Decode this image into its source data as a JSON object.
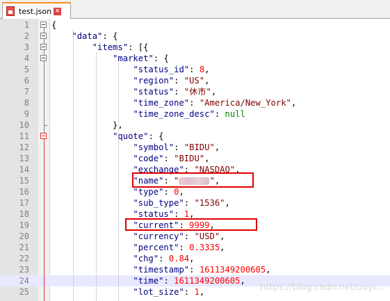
{
  "tab": {
    "title": "test.json",
    "close_symbol": "×",
    "file_icon": "file-icon"
  },
  "watermark": "https://blog.csdn.net/ouyi...",
  "colors": {
    "key": "#000080",
    "string": "#800000",
    "number": "#ff0000",
    "keyword": "#008000",
    "highlight_line": "#e8e8ff",
    "annotation_box": "#e00000"
  },
  "highlight_line": 24,
  "annotated_lines": [
    15,
    19
  ],
  "lines": [
    {
      "n": "1",
      "parts": [
        [
          "op",
          "{"
        ]
      ]
    },
    {
      "n": "2",
      "parts": [
        [
          "op",
          "    "
        ],
        [
          "key",
          "\"data\""
        ],
        [
          "op",
          ": {"
        ]
      ]
    },
    {
      "n": "3",
      "parts": [
        [
          "op",
          "        "
        ],
        [
          "key",
          "\"items\""
        ],
        [
          "op",
          ": [{"
        ]
      ]
    },
    {
      "n": "4",
      "parts": [
        [
          "op",
          "            "
        ],
        [
          "key",
          "\"market\""
        ],
        [
          "op",
          ": {"
        ]
      ]
    },
    {
      "n": "5",
      "parts": [
        [
          "op",
          "                "
        ],
        [
          "key",
          "\"status_id\""
        ],
        [
          "op",
          ": "
        ],
        [
          "num",
          "8"
        ],
        [
          "op",
          ","
        ]
      ]
    },
    {
      "n": "6",
      "parts": [
        [
          "op",
          "                "
        ],
        [
          "key",
          "\"region\""
        ],
        [
          "op",
          ": "
        ],
        [
          "str",
          "\"US\""
        ],
        [
          "op",
          ","
        ]
      ]
    },
    {
      "n": "7",
      "parts": [
        [
          "op",
          "                "
        ],
        [
          "key",
          "\"status\""
        ],
        [
          "op",
          ": "
        ],
        [
          "str",
          "\"休市\""
        ],
        [
          "op",
          ","
        ]
      ]
    },
    {
      "n": "8",
      "parts": [
        [
          "op",
          "                "
        ],
        [
          "key",
          "\"time_zone\""
        ],
        [
          "op",
          ": "
        ],
        [
          "str",
          "\"America/New_York\""
        ],
        [
          "op",
          ","
        ]
      ]
    },
    {
      "n": "9",
      "parts": [
        [
          "op",
          "                "
        ],
        [
          "key",
          "\"time_zone_desc\""
        ],
        [
          "op",
          ": "
        ],
        [
          "kw",
          "null"
        ]
      ]
    },
    {
      "n": "10",
      "parts": [
        [
          "op",
          "            },"
        ]
      ]
    },
    {
      "n": "11",
      "parts": [
        [
          "op",
          "            "
        ],
        [
          "key",
          "\"quote\""
        ],
        [
          "op",
          ": {"
        ]
      ]
    },
    {
      "n": "12",
      "parts": [
        [
          "op",
          "                "
        ],
        [
          "key",
          "\"symbol\""
        ],
        [
          "op",
          ": "
        ],
        [
          "str",
          "\"BIDU\""
        ],
        [
          "op",
          ","
        ]
      ]
    },
    {
      "n": "13",
      "parts": [
        [
          "op",
          "                "
        ],
        [
          "key",
          "\"code\""
        ],
        [
          "op",
          ": "
        ],
        [
          "str",
          "\"BIDU\""
        ],
        [
          "op",
          ","
        ]
      ]
    },
    {
      "n": "14",
      "parts": [
        [
          "op",
          "                "
        ],
        [
          "key",
          "\"exchange\""
        ],
        [
          "op",
          ": "
        ],
        [
          "str",
          "\"NASDAQ\""
        ],
        [
          "op",
          ","
        ]
      ]
    },
    {
      "n": "15",
      "parts": [
        [
          "op",
          "                "
        ],
        [
          "key",
          "\"name\""
        ],
        [
          "op",
          ": "
        ],
        [
          "str",
          "\""
        ],
        [
          "blur",
          ""
        ],
        [
          "str",
          "\""
        ],
        [
          "op",
          ","
        ]
      ]
    },
    {
      "n": "16",
      "parts": [
        [
          "op",
          "                "
        ],
        [
          "key",
          "\"type\""
        ],
        [
          "op",
          ": "
        ],
        [
          "num",
          "0"
        ],
        [
          "op",
          ","
        ]
      ]
    },
    {
      "n": "17",
      "parts": [
        [
          "op",
          "                "
        ],
        [
          "key",
          "\"sub_type\""
        ],
        [
          "op",
          ": "
        ],
        [
          "str",
          "\"1536\""
        ],
        [
          "op",
          ","
        ]
      ]
    },
    {
      "n": "18",
      "parts": [
        [
          "op",
          "                "
        ],
        [
          "key",
          "\"status\""
        ],
        [
          "op",
          ": "
        ],
        [
          "num",
          "1"
        ],
        [
          "op",
          ","
        ]
      ]
    },
    {
      "n": "19",
      "parts": [
        [
          "op",
          "                "
        ],
        [
          "key",
          "\"current\""
        ],
        [
          "op",
          ": "
        ],
        [
          "num",
          "9999"
        ],
        [
          "op",
          ","
        ]
      ]
    },
    {
      "n": "20",
      "parts": [
        [
          "op",
          "                "
        ],
        [
          "key",
          "\"currency\""
        ],
        [
          "op",
          ": "
        ],
        [
          "str",
          "\"USD\""
        ],
        [
          "op",
          ","
        ]
      ]
    },
    {
      "n": "21",
      "parts": [
        [
          "op",
          "                "
        ],
        [
          "key",
          "\"percent\""
        ],
        [
          "op",
          ": "
        ],
        [
          "num",
          "0.3335"
        ],
        [
          "op",
          ","
        ]
      ]
    },
    {
      "n": "22",
      "parts": [
        [
          "op",
          "                "
        ],
        [
          "key",
          "\"chg\""
        ],
        [
          "op",
          ": "
        ],
        [
          "num",
          "0.84"
        ],
        [
          "op",
          ","
        ]
      ]
    },
    {
      "n": "23",
      "parts": [
        [
          "op",
          "                "
        ],
        [
          "key",
          "\"timestamp\""
        ],
        [
          "op",
          ": "
        ],
        [
          "num",
          "1611349200605"
        ],
        [
          "op",
          ","
        ]
      ]
    },
    {
      "n": "24",
      "parts": [
        [
          "op",
          "                "
        ],
        [
          "key",
          "\"time\""
        ],
        [
          "op",
          ": "
        ],
        [
          "num",
          "1611349200605"
        ],
        [
          "op",
          ","
        ]
      ]
    },
    {
      "n": "25",
      "parts": [
        [
          "op",
          "                "
        ],
        [
          "key",
          "\"lot_size\""
        ],
        [
          "op",
          ": "
        ],
        [
          "num",
          "1"
        ],
        [
          "op",
          ","
        ]
      ]
    }
  ]
}
